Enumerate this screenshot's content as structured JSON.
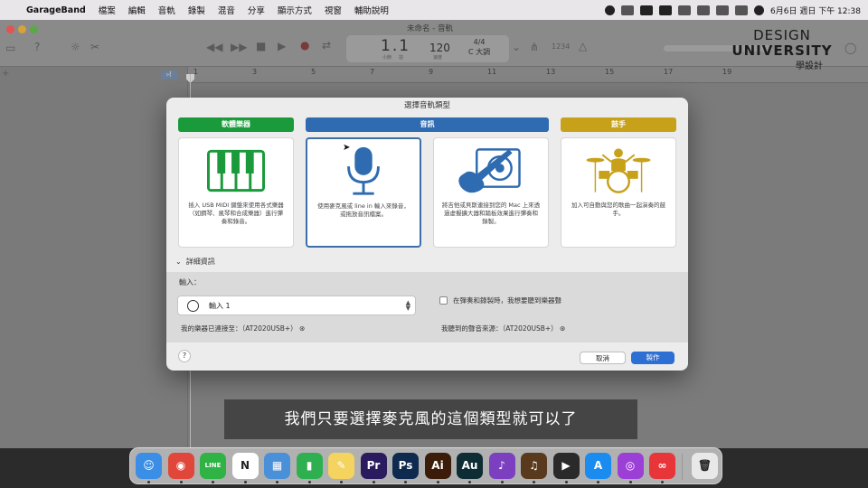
{
  "menubar": {
    "app": "GarageBand",
    "items": [
      "檔案",
      "編輯",
      "音軌",
      "錄製",
      "混音",
      "分享",
      "顯示方式",
      "視窗",
      "輔助說明"
    ],
    "clock": "6月6日 週日 下午 12:38"
  },
  "window": {
    "title": "未命名 - 音軌",
    "lcd": {
      "position": "1.1",
      "tempo": "120",
      "time_signature": "4/4",
      "key": "C 大調",
      "bar_label": "小節",
      "beat_label": "拍",
      "tempo_label": "速度"
    },
    "ruler_ticks": [
      "1",
      "3",
      "5",
      "7",
      "9",
      "11",
      "13",
      "15",
      "17",
      "19"
    ],
    "count_in": "1234"
  },
  "watermark": {
    "line1": "DESIGN",
    "line2": "UNIVERSITY",
    "line3": "學設計"
  },
  "dialog": {
    "title": "選擇音軌類型",
    "categories": [
      {
        "label": "軟體樂器",
        "color": "#1a9a3a"
      },
      {
        "label": "音訊",
        "color": "#2f6bb0"
      },
      {
        "label": "鼓手",
        "color": "#c8a11a"
      }
    ],
    "cards": [
      {
        "name": "software-instrument",
        "description": "插入 USB MIDI 鍵盤來使用各式樂器（如鋼琴、風琴和合成樂器）進行彈奏和錄音。"
      },
      {
        "name": "microphone",
        "description": "使用麥克風或 line in 輸入來錄音，或拖放音訊檔案。",
        "selected": true
      },
      {
        "name": "guitar",
        "description": "將吉他或貝斯連接到您的 Mac 上來透過虛擬擴大器和踏板效果進行彈奏和錄製。"
      },
      {
        "name": "drummer",
        "description": "加入可自動與您的歌曲一起演奏的鼓手。"
      }
    ],
    "details_toggle": "詳細資訊",
    "input_label": "輸入：",
    "input_value": "輸入 1",
    "instrument_connected": "我的樂器已連接至：（AT2020USB+）",
    "monitor_checkbox_label": "在彈奏和錄製時，我想要聽到樂器聲",
    "monitor_checked": false,
    "hearing_source": "我聽到的聲音來源：（AT2020USB+）",
    "help": "?",
    "cancel_label": "取消",
    "create_label": "製作"
  },
  "subtitle": "我們只要選擇麥克風的這個類型就可以了",
  "dock": {
    "apps": [
      {
        "name": "finder",
        "glyph": "☺",
        "color": "#3a8ee6"
      },
      {
        "name": "chrome",
        "glyph": "◉",
        "color": "#e0463a"
      },
      {
        "name": "line",
        "glyph": "LINE",
        "color": "#2fb344"
      },
      {
        "name": "notion",
        "glyph": "N",
        "color": "#ffffff"
      },
      {
        "name": "keynote",
        "glyph": "▦",
        "color": "#4a90d9"
      },
      {
        "name": "numbers",
        "glyph": "▮",
        "color": "#2fb050"
      },
      {
        "name": "notes-app",
        "glyph": "✎",
        "color": "#f4d35e"
      },
      {
        "name": "premiere-pro",
        "glyph": "Pr",
        "color": "#2a1b5e"
      },
      {
        "name": "photoshop",
        "glyph": "Ps",
        "color": "#0e2a4f"
      },
      {
        "name": "illustrator",
        "glyph": "Ai",
        "color": "#3b1c0a"
      },
      {
        "name": "audition",
        "glyph": "Au",
        "color": "#0d2c33"
      },
      {
        "name": "soundwave",
        "glyph": "♪",
        "color": "#7b3fbf"
      },
      {
        "name": "garageband",
        "glyph": "♫",
        "color": "#5a3a1c"
      },
      {
        "name": "final-cut-pro",
        "glyph": "▶",
        "color": "#2a2a2a"
      },
      {
        "name": "app-store",
        "glyph": "A",
        "color": "#1a8cf0"
      },
      {
        "name": "podcasts",
        "glyph": "◎",
        "color": "#9b3fd6"
      },
      {
        "name": "creative-cloud",
        "glyph": "∞",
        "color": "#e8353a"
      },
      {
        "name": "trash",
        "glyph": "🗑",
        "color": "#e8e8e8"
      }
    ]
  }
}
